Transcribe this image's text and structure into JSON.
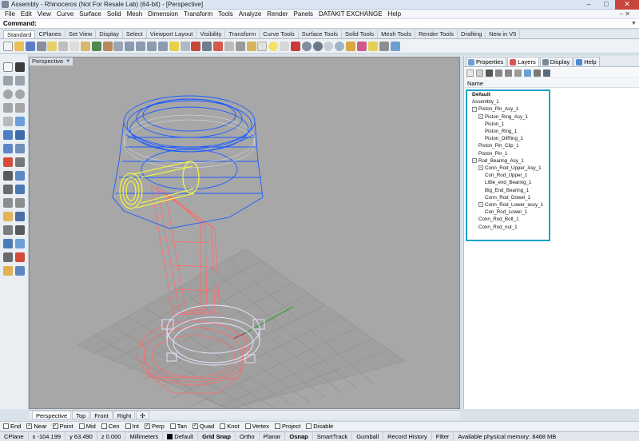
{
  "window": {
    "title": "Assembly - Rhinoceros (Not For Resale Lab) (64-bit) - [Perspective]",
    "controls": [
      "–",
      "□",
      "✕"
    ]
  },
  "menu": {
    "items": [
      "File",
      "Edit",
      "View",
      "Curve",
      "Surface",
      "Solid",
      "Mesh",
      "Dimension",
      "Transform",
      "Tools",
      "Analyze",
      "Render",
      "Panels",
      "DATAKIT EXCHANGE",
      "Help"
    ],
    "right": "– ✕"
  },
  "command": {
    "label": "Command:",
    "value": ""
  },
  "toolbar_tabs": [
    "Standard",
    "CPlanes",
    "Set View",
    "Display",
    "Select",
    "Viewport Layout",
    "Visibility",
    "Transform",
    "Curve Tools",
    "Surface Tools",
    "Solid Tools",
    "Mesh Tools",
    "Render Tools",
    "Drafting",
    "New in V5"
  ],
  "active_toolbar_tab": "Standard",
  "viewport": {
    "label": "Perspective",
    "tabs": [
      "Perspective",
      "Top",
      "Front",
      "Right",
      "✣"
    ],
    "active_tab": "Perspective",
    "colors": {
      "background": "#a7a7a7",
      "grid": "#8f8f8f",
      "piston": "#1b5cff",
      "pin": "#ffff33",
      "rod": "#ff6b6b",
      "bearing": "#e9e3ff"
    }
  },
  "panel": {
    "tabs": [
      "Properties",
      "Layers",
      "Display",
      "Help"
    ],
    "active_tab": "Layers",
    "header": "Name",
    "layers": [
      {
        "name": "Default",
        "level": 0,
        "bold": true,
        "toggle": ""
      },
      {
        "name": "Assembly_1",
        "level": 0,
        "toggle": ""
      },
      {
        "name": "Piston_Pin_Asy_1",
        "level": 0,
        "toggle": "−"
      },
      {
        "name": "Piston_Ring_Asy_1",
        "level": 1,
        "toggle": "−"
      },
      {
        "name": "Piston_1",
        "level": 2,
        "toggle": ""
      },
      {
        "name": "Piston_Ring_1",
        "level": 2,
        "toggle": ""
      },
      {
        "name": "Piston_OilRing_1",
        "level": 2,
        "toggle": ""
      },
      {
        "name": "Piston_Pin_Clip_1",
        "level": 1,
        "toggle": ""
      },
      {
        "name": "Piston_Pin_1",
        "level": 1,
        "toggle": ""
      },
      {
        "name": "Rod_Bearing_Asy_1",
        "level": 0,
        "toggle": "−"
      },
      {
        "name": "Conn_Rod_Upper_Asy_1",
        "level": 1,
        "toggle": "−"
      },
      {
        "name": "Con_Rod_Upper_1",
        "level": 2,
        "toggle": ""
      },
      {
        "name": "Little_end_Bearing_1",
        "level": 2,
        "toggle": ""
      },
      {
        "name": "Big_End_Bearing_1",
        "level": 2,
        "toggle": ""
      },
      {
        "name": "Conn_Rod_Dowel_1",
        "level": 2,
        "toggle": ""
      },
      {
        "name": "Conn_Rod_Lower_assy_1",
        "level": 1,
        "toggle": "−"
      },
      {
        "name": "Con_Rod_Lower_1",
        "level": 2,
        "toggle": ""
      },
      {
        "name": "Conn_Rod_Bolt_1",
        "level": 1,
        "toggle": ""
      },
      {
        "name": "Conn_Rod_nut_1",
        "level": 1,
        "toggle": ""
      }
    ],
    "highlight_color": "#1aa3cc"
  },
  "osnaps": [
    {
      "label": "End",
      "checked": false
    },
    {
      "label": "Near",
      "checked": true
    },
    {
      "label": "Point",
      "checked": true
    },
    {
      "label": "Mid",
      "checked": false
    },
    {
      "label": "Cen",
      "checked": false
    },
    {
      "label": "Int",
      "checked": false
    },
    {
      "label": "Perp",
      "checked": true
    },
    {
      "label": "Tan",
      "checked": false
    },
    {
      "label": "Quad",
      "checked": true
    },
    {
      "label": "Knot",
      "checked": false
    },
    {
      "label": "Vertex",
      "checked": false
    },
    {
      "label": "Project",
      "checked": false
    },
    {
      "label": "Disable",
      "checked": false
    }
  ],
  "status": {
    "cplane": "CPlane",
    "x": "x -104.199",
    "y": "y 63.490",
    "z": "z 0.000",
    "units": "Millimeters",
    "layer": "Default",
    "toggles": [
      "Grid Snap",
      "Ortho",
      "Planar",
      "Osnap",
      "SmartTrack",
      "Gumball",
      "Record History",
      "Filter"
    ],
    "bold_toggles": [
      "Grid Snap",
      "Osnap"
    ],
    "memory": "Available physical memory: 8468 MB"
  }
}
